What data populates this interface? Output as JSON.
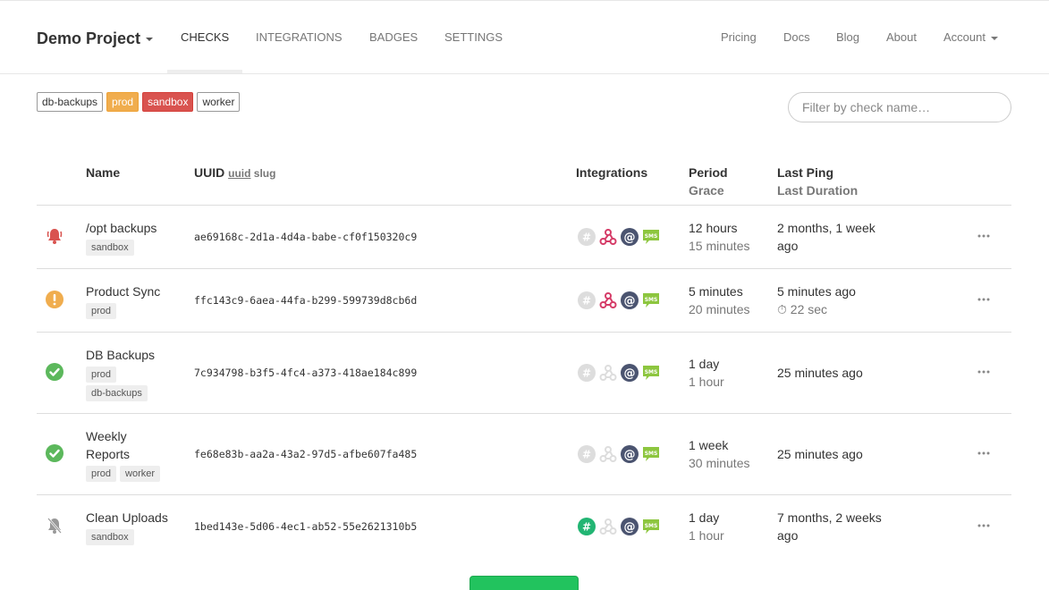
{
  "navbar": {
    "project": "Demo Project",
    "tabs": [
      {
        "label": "CHECKS"
      },
      {
        "label": "INTEGRATIONS"
      },
      {
        "label": "BADGES"
      },
      {
        "label": "SETTINGS"
      }
    ],
    "right": [
      {
        "label": "Pricing"
      },
      {
        "label": "Docs"
      },
      {
        "label": "Blog"
      },
      {
        "label": "About"
      },
      {
        "label": "Account"
      }
    ]
  },
  "tag_filters": [
    "db-backups",
    "prod",
    "sandbox",
    "worker"
  ],
  "filter": {
    "placeholder": "Filter by check name…"
  },
  "table": {
    "headers": {
      "name": "Name",
      "uuid": "UUID",
      "uuid_opt": "uuid",
      "slug_opt": "slug",
      "integrations": "Integrations",
      "period": "Period",
      "grace": "Grace",
      "last_ping": "Last Ping",
      "last_duration": "Last Duration"
    },
    "rows": [
      {
        "status": "down-alert",
        "name": "/opt backups",
        "tags": [
          "sandbox"
        ],
        "uuid": "ae69168c-2d1a-4d4a-babe-cf0f150320c9",
        "integrations": {
          "slack": false,
          "webhook": true,
          "email": true,
          "sms": true
        },
        "period": "12 hours",
        "grace": "15 minutes",
        "last_ping": "2 months, 1 week ago",
        "last_duration": ""
      },
      {
        "status": "grace",
        "name": "Product Sync",
        "tags": [
          "prod"
        ],
        "uuid": "ffc143c9-6aea-44fa-b299-599739d8cb6d",
        "integrations": {
          "slack": false,
          "webhook": true,
          "email": true,
          "sms": true
        },
        "period": "5 minutes",
        "grace": "20 minutes",
        "last_ping": "5 minutes ago",
        "last_duration": "⏱ 22 sec"
      },
      {
        "status": "up",
        "name": "DB Backups",
        "tags": [
          "prod",
          "db-backups"
        ],
        "uuid": "7c934798-b3f5-4fc4-a373-418ae184c899",
        "integrations": {
          "slack": false,
          "webhook": false,
          "email": true,
          "sms": true
        },
        "period": "1 day",
        "grace": "1 hour",
        "last_ping": "25 minutes ago",
        "last_duration": ""
      },
      {
        "status": "up",
        "name": "Weekly Reports",
        "tags": [
          "prod",
          "worker"
        ],
        "uuid": "fe68e83b-aa2a-43a2-97d5-afbe607fa485",
        "integrations": {
          "slack": false,
          "webhook": false,
          "email": true,
          "sms": true
        },
        "period": "1 week",
        "grace": "30 minutes",
        "last_ping": "25 minutes ago",
        "last_duration": ""
      },
      {
        "status": "paused",
        "name": "Clean Uploads",
        "tags": [
          "sandbox"
        ],
        "uuid": "1bed143e-5d06-4ec1-ab52-55e2621310b5",
        "integrations": {
          "slack": true,
          "webhook": false,
          "email": true,
          "sms": true
        },
        "period": "1 day",
        "grace": "1 hour",
        "last_ping": "7 months, 2 weeks ago",
        "last_duration": ""
      }
    ]
  },
  "colors": {
    "down": "#d9534f",
    "grace": "#f0ad4e",
    "up": "#5cb85c",
    "paused": "#999999",
    "webhook_on": "#d53c68",
    "email": "#4b5470",
    "sms": "#8dc63f",
    "slack_on": "#22b573",
    "off": "#dddddd",
    "primary_button": "#22c35e"
  }
}
